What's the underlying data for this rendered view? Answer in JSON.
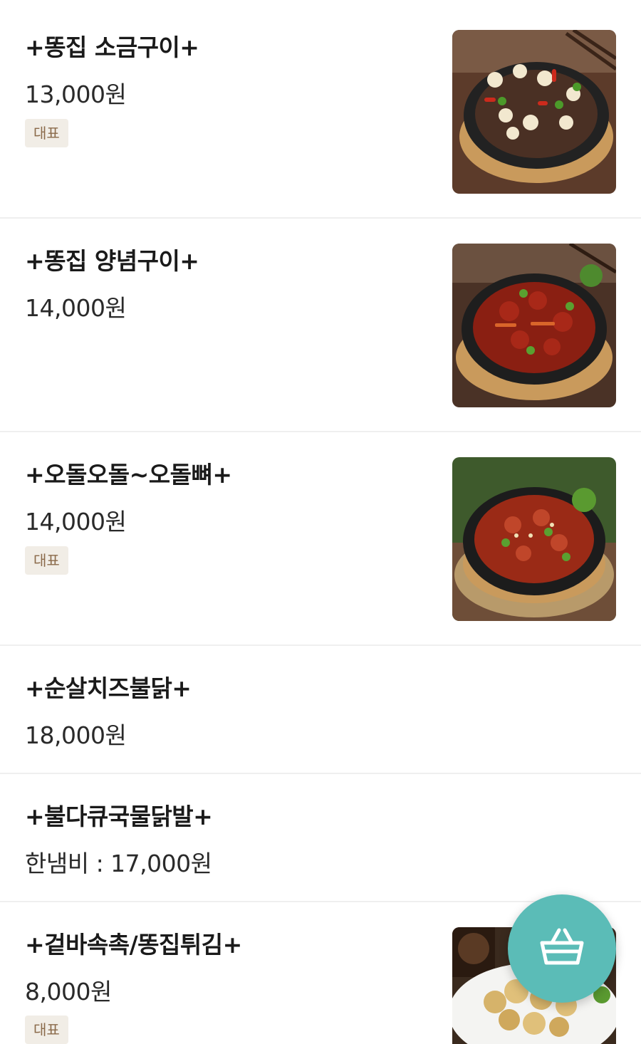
{
  "theme": {
    "badge_bg": "#f1ede6",
    "badge_text": "#8a6a4a",
    "accent": "#5bbcb7",
    "divider": "#efefef"
  },
  "menu": {
    "items": [
      {
        "name": "+똥집 소금구이+",
        "price": "13,000원",
        "badge": "대표",
        "photo_icon": "salt-grilled-gizzard-photo"
      },
      {
        "name": "+똥집 양념구이+",
        "price": "14,000원",
        "photo_icon": "spicy-grilled-gizzard-photo"
      },
      {
        "name": "+오돌오돌~오돌뼈+",
        "price": "14,000원",
        "badge": "대표",
        "photo_icon": "cartilage-photo"
      },
      {
        "name": "+순살치즈불닭+",
        "price": "18,000원"
      },
      {
        "name": "+불다큐국물닭발+",
        "price": "한냄비 : 17,000원"
      },
      {
        "name": "+겉바속촉/똥집튀김+",
        "price": "8,000원",
        "badge": "대표",
        "photo_icon": "fried-gizzard-photo"
      }
    ]
  },
  "cart_button": {
    "icon": "shopping-basket-icon"
  }
}
